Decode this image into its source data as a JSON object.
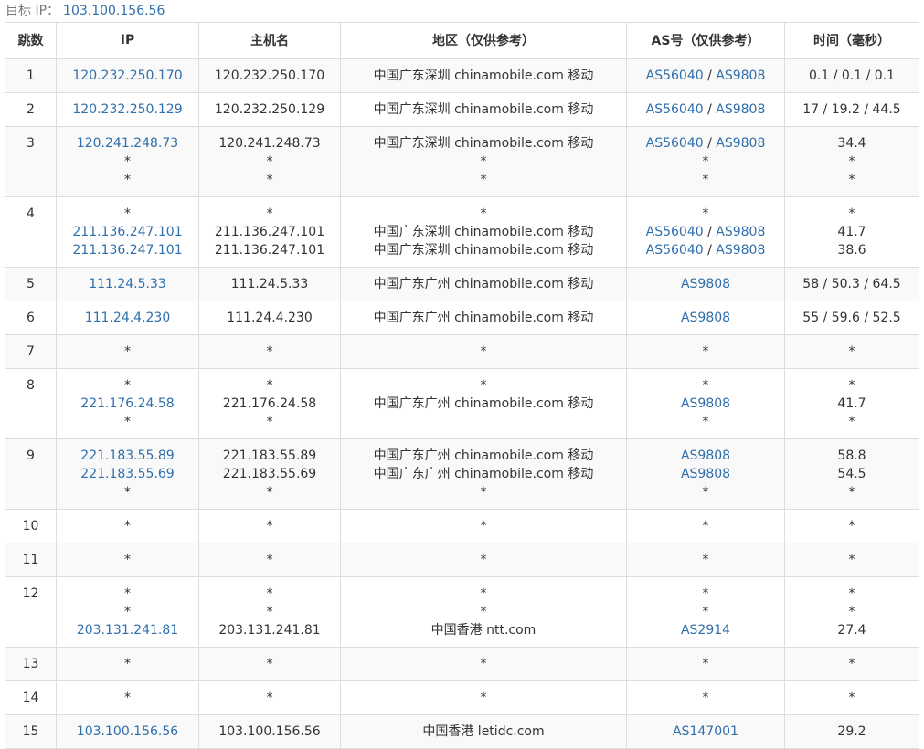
{
  "target": {
    "label": "目标 IP：",
    "ip": "103.100.156.56"
  },
  "headers": [
    "跳数",
    "IP",
    "主机名",
    "地区（仅供参考）",
    "AS号（仅供参考）",
    "时间（毫秒）"
  ],
  "rows": [
    {
      "hop": "1",
      "h": 37,
      "lines": [
        {
          "ip": "120.232.250.170",
          "host": "120.232.250.170",
          "region": "中国广东深圳 chinamobile.com 移动",
          "as": [
            "AS56040",
            "AS9808"
          ],
          "time": "0.1 / 0.1 / 0.1"
        }
      ]
    },
    {
      "hop": "2",
      "h": 37,
      "lines": [
        {
          "ip": "120.232.250.129",
          "host": "120.232.250.129",
          "region": "中国广东深圳 chinamobile.com 移动",
          "as": [
            "AS56040",
            "AS9808"
          ],
          "time": "17 / 19.2 / 44.5"
        }
      ]
    },
    {
      "hop": "3",
      "h": 77,
      "lines": [
        {
          "ip": "120.241.248.73",
          "host": "120.241.248.73",
          "region": "中国广东深圳 chinamobile.com 移动",
          "as": [
            "AS56040",
            "AS9808"
          ],
          "time": "34.4"
        },
        {
          "ip": "*",
          "host": "*",
          "region": "*",
          "as": [
            "*"
          ],
          "time": "*"
        },
        {
          "ip": "*",
          "host": "*",
          "region": "*",
          "as": [
            "*"
          ],
          "time": "*"
        }
      ]
    },
    {
      "hop": "4",
      "h": 77,
      "lines": [
        {
          "ip": "*",
          "host": "*",
          "region": "*",
          "as": [
            "*"
          ],
          "time": "*"
        },
        {
          "ip": "211.136.247.101",
          "host": "211.136.247.101",
          "region": "中国广东深圳 chinamobile.com 移动",
          "as": [
            "AS56040",
            "AS9808"
          ],
          "time": "41.7"
        },
        {
          "ip": "211.136.247.101",
          "host": "211.136.247.101",
          "region": "中国广东深圳 chinamobile.com 移动",
          "as": [
            "AS56040",
            "AS9808"
          ],
          "time": "38.6"
        }
      ]
    },
    {
      "hop": "5",
      "h": 37,
      "lines": [
        {
          "ip": "111.24.5.33",
          "host": "111.24.5.33",
          "region": "中国广东广州 chinamobile.com 移动",
          "as": [
            "AS9808"
          ],
          "time": "58 / 50.3 / 64.5"
        }
      ]
    },
    {
      "hop": "6",
      "h": 37,
      "lines": [
        {
          "ip": "111.24.4.230",
          "host": "111.24.4.230",
          "region": "中国广东广州 chinamobile.com 移动",
          "as": [
            "AS9808"
          ],
          "time": "55 / 59.6 / 52.5"
        }
      ]
    },
    {
      "hop": "7",
      "h": 37,
      "lines": [
        {
          "ip": "*",
          "host": "*",
          "region": "*",
          "as": [
            "*"
          ],
          "time": "*"
        }
      ]
    },
    {
      "hop": "8",
      "h": 77,
      "lines": [
        {
          "ip": "*",
          "host": "*",
          "region": "*",
          "as": [
            "*"
          ],
          "time": "*"
        },
        {
          "ip": "221.176.24.58",
          "host": "221.176.24.58",
          "region": "中国广东广州 chinamobile.com 移动",
          "as": [
            "AS9808"
          ],
          "time": "41.7"
        },
        {
          "ip": "*",
          "host": "*",
          "region": "",
          "as": [
            "*"
          ],
          "time": "*"
        }
      ]
    },
    {
      "hop": "9",
      "h": 77,
      "lines": [
        {
          "ip": "221.183.55.89",
          "host": "221.183.55.89",
          "region": "中国广东广州 chinamobile.com 移动",
          "as": [
            "AS9808"
          ],
          "time": "58.8"
        },
        {
          "ip": "221.183.55.69",
          "host": "221.183.55.69",
          "region": "中国广东广州 chinamobile.com 移动",
          "as": [
            "AS9808"
          ],
          "time": "54.5"
        },
        {
          "ip": "*",
          "host": "*",
          "region": "*",
          "as": [
            "*"
          ],
          "time": "*"
        }
      ]
    },
    {
      "hop": "10",
      "h": 37,
      "lines": [
        {
          "ip": "*",
          "host": "*",
          "region": "*",
          "as": [
            "*"
          ],
          "time": "*"
        }
      ]
    },
    {
      "hop": "11",
      "h": 37,
      "lines": [
        {
          "ip": "*",
          "host": "*",
          "region": "*",
          "as": [
            "*"
          ],
          "time": "*"
        }
      ]
    },
    {
      "hop": "12",
      "h": 77,
      "lines": [
        {
          "ip": "*",
          "host": "*",
          "region": "*",
          "as": [
            "*"
          ],
          "time": "*"
        },
        {
          "ip": "*",
          "host": "*",
          "region": "*",
          "as": [
            "*"
          ],
          "time": "*"
        },
        {
          "ip": "203.131.241.81",
          "host": "203.131.241.81",
          "region": "中国香港 ntt.com",
          "as": [
            "AS2914"
          ],
          "time": "27.4"
        }
      ]
    },
    {
      "hop": "13",
      "h": 37,
      "lines": [
        {
          "ip": "*",
          "host": "*",
          "region": "*",
          "as": [
            "*"
          ],
          "time": "*"
        }
      ]
    },
    {
      "hop": "14",
      "h": 37,
      "lines": [
        {
          "ip": "*",
          "host": "*",
          "region": "*",
          "as": [
            "*"
          ],
          "time": "*"
        }
      ]
    },
    {
      "hop": "15",
      "h": 37,
      "lines": [
        {
          "ip": "103.100.156.56",
          "host": "103.100.156.56",
          "region": "中国香港 letidc.com",
          "as": [
            "AS147001"
          ],
          "time": "29.2"
        }
      ]
    }
  ]
}
